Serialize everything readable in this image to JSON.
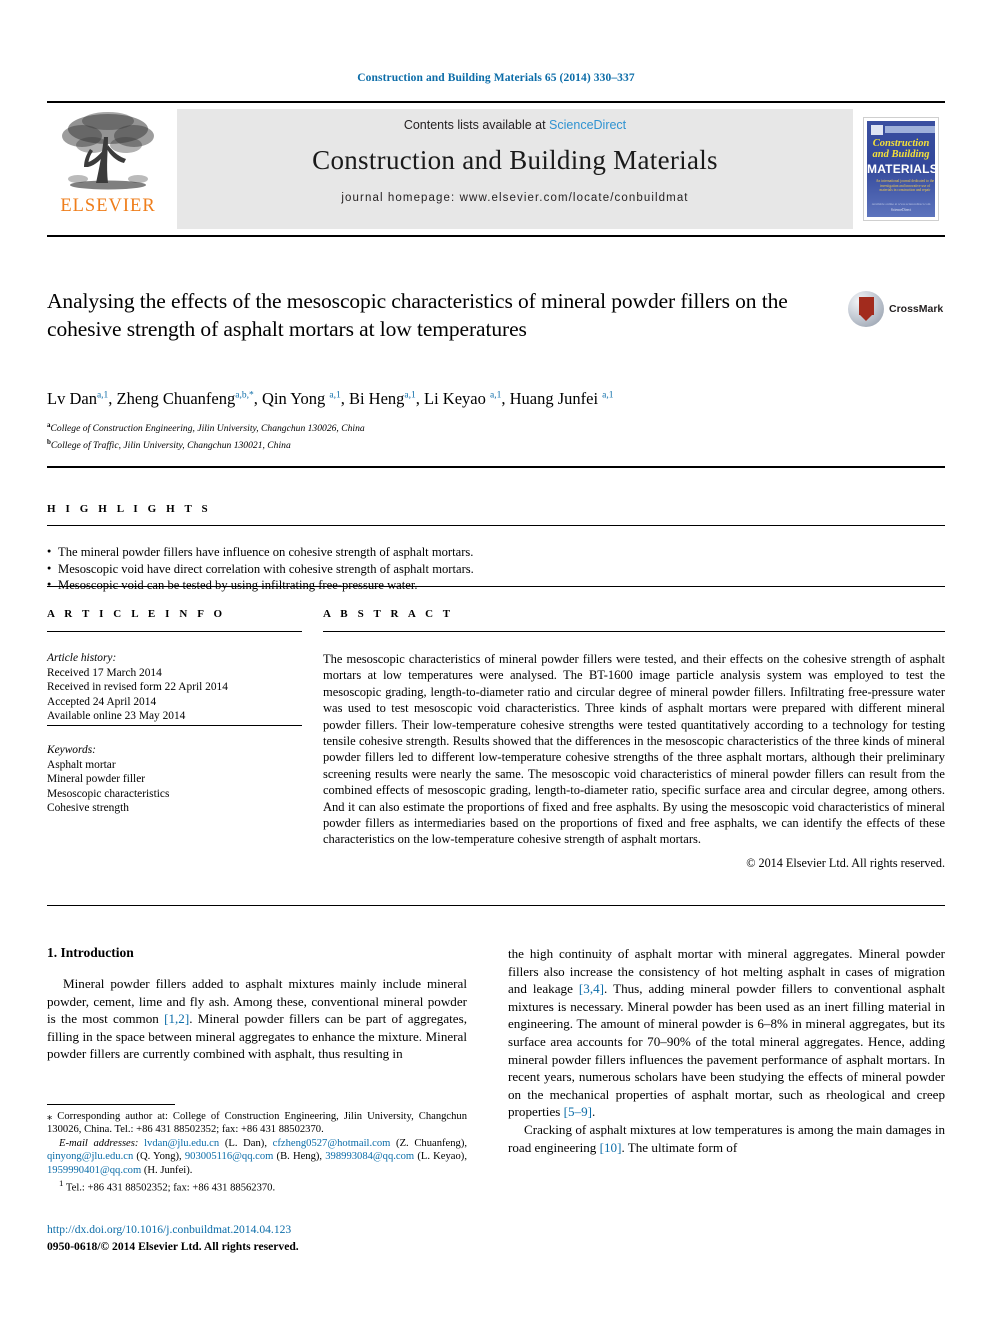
{
  "running_head": "Construction and Building Materials 65 (2014) 330–337",
  "masthead": {
    "publisher_name": "ELSEVIER",
    "contents_prefix": "Contents lists available at ",
    "sciencedirect": "ScienceDirect",
    "journal_title": "Construction and Building Materials",
    "homepage": "journal homepage: www.elsevier.com/locate/conbuildmat",
    "cover": {
      "line1": "Construction",
      "line2": "and Building",
      "line3": "MATERIALS",
      "subtitle": "An international journal dedicated to the investigation and innovative use of materials in construction and repair",
      "footer_top": "Available online at www.sciencedirect.com",
      "footer": "ScienceDirect"
    }
  },
  "article": {
    "title": "Analysing the effects of the mesoscopic characteristics of mineral powder fillers on the cohesive strength of asphalt mortars at low temperatures",
    "crossmark_label": "CrossMark",
    "authors": [
      {
        "name": "Lv Dan",
        "sup": "a,1",
        "sep": ", "
      },
      {
        "name": "Zheng Chuanfeng",
        "sup": "a,b,*",
        "sep": ", "
      },
      {
        "name": "Qin Yong ",
        "sup": "a,1",
        "sep": ", "
      },
      {
        "name": "Bi Heng",
        "sup": "a,1",
        "sep": ", "
      },
      {
        "name": "Li Keyao ",
        "sup": "a,1",
        "sep": ", "
      },
      {
        "name": "Huang Junfei ",
        "sup": "a,1",
        "sep": ""
      }
    ],
    "affiliations": [
      {
        "mark": "a",
        "text": "College of Construction Engineering, Jilin University, Changchun 130026, China"
      },
      {
        "mark": "b",
        "text": "College of Traffic, Jilin University, Changchun 130021, China"
      }
    ]
  },
  "highlights": {
    "heading": "H I G H L I G H T S",
    "items": [
      "The mineral powder fillers have influence on cohesive strength of asphalt mortars.",
      "Mesoscopic void have direct correlation with cohesive strength of asphalt mortars.",
      "Mesoscopic void can be tested by using infiltrating free-pressure water."
    ]
  },
  "article_info": {
    "heading": "A R T I C L E    I N F O",
    "history_label": "Article history:",
    "history": [
      "Received 17 March 2014",
      "Received in revised form 22 April 2014",
      "Accepted 24 April 2014",
      "Available online 23 May 2014"
    ],
    "keywords_label": "Keywords:",
    "keywords": [
      "Asphalt mortar",
      "Mineral powder filler",
      "Mesoscopic characteristics",
      "Cohesive strength"
    ]
  },
  "abstract": {
    "heading": "A B S T R A C T",
    "text": "The mesoscopic characteristics of mineral powder fillers were tested, and their effects on the cohesive strength of asphalt mortars at low temperatures were analysed. The BT-1600 image particle analysis system was employed to test the mesoscopic grading, length-to-diameter ratio and circular degree of mineral powder fillers. Infiltrating free-pressure water was used to test mesoscopic void characteristics. Three kinds of asphalt mortars were prepared with different mineral powder fillers. Their low-temperature cohesive strengths were tested quantitatively according to a technology for testing tensile cohesive strength. Results showed that the differences in the mesoscopic characteristics of the three kinds of mineral powder fillers led to different low-temperature cohesive strengths of the three asphalt mortars, although their preliminary screening results were nearly the same. The mesoscopic void characteristics of mineral powder fillers can result from the combined effects of mesoscopic grading, length-to-diameter ratio, specific surface area and circular degree, among others. And it can also estimate the proportions of fixed and free asphalts. By using the mesoscopic void characteristics of mineral powder fillers as intermediaries based on the proportions of fixed and free asphalts, we can identify the effects of these characteristics on the low-temperature cohesive strength of asphalt mortars.",
    "copyright": "© 2014 Elsevier Ltd. All rights reserved."
  },
  "introduction": {
    "heading": "1. Introduction",
    "left_p1_a": "Mineral powder fillers added to asphalt mixtures mainly include mineral powder, cement, lime and fly ash. Among these, conventional mineral powder is the most common ",
    "left_p1_ref": "[1,2]",
    "left_p1_b": ". Mineral powder fillers can be part of aggregates, filling in the space between mineral aggregates to enhance the mixture. Mineral powder fillers are currently combined with asphalt, thus resulting in",
    "right_p1_a": "the high continuity of asphalt mortar with mineral aggregates. Mineral powder fillers also increase the consistency of hot melting asphalt in cases of migration and leakage ",
    "right_p1_ref": "[3,4]",
    "right_p1_b": ". Thus, adding mineral powder fillers to conventional asphalt mixtures is necessary. Mineral powder has been used as an inert filling material in engineering. The amount of mineral powder is 6–8% in mineral aggregates, but its surface area accounts for 70–90% of the total mineral aggregates. Hence, adding mineral powder fillers influences the pavement performance of asphalt mortars. In recent years, numerous scholars have been studying the effects of mineral powder on the mechanical properties of asphalt mortar, such as rheological and creep properties ",
    "right_p1_ref2": "[5–9]",
    "right_p1_c": ".",
    "right_p2_a": "Cracking of asphalt mixtures at low temperatures is among the main damages in road engineering ",
    "right_p2_ref": "[10]",
    "right_p2_b": ". The ultimate form of"
  },
  "footnotes": {
    "corresponding": "⁎ Corresponding author at: College of Construction Engineering, Jilin University, Changchun 130026, China. Tel.: +86 431 88502352; fax: +86 431 88502370.",
    "email_label": "E-mail addresses:",
    "emails": [
      {
        "addr": "lvdan@jlu.edu.cn",
        "who": " (L. Dan), "
      },
      {
        "addr": "cfzheng0527@hotmail.com",
        "who": " (Z. Chuanfeng), "
      },
      {
        "addr": "qinyong@jlu.edu.cn",
        "who": " (Q. Yong), "
      },
      {
        "addr": "903005116@qq.com",
        "who": " (B. Heng), "
      },
      {
        "addr": "398993084@qq.com",
        "who": " (L. Keyao), "
      },
      {
        "addr": "1959990401@qq.com",
        "who": " (H. Junfei)."
      }
    ],
    "tel_note_mark": "1",
    "tel_note": "Tel.: +86 431 88502352; fax: +86 431 88562370."
  },
  "footer": {
    "doi": "http://dx.doi.org/10.1016/j.conbuildmat.2014.04.123",
    "issn": "0950-0618/© 2014 Elsevier Ltd. All rights reserved."
  },
  "colors": {
    "link_blue": "#0b6ca8",
    "sd_blue": "#2f93d1",
    "elsevier_orange": "#ef7d1a",
    "banner_grey": "#e7e7e7"
  }
}
